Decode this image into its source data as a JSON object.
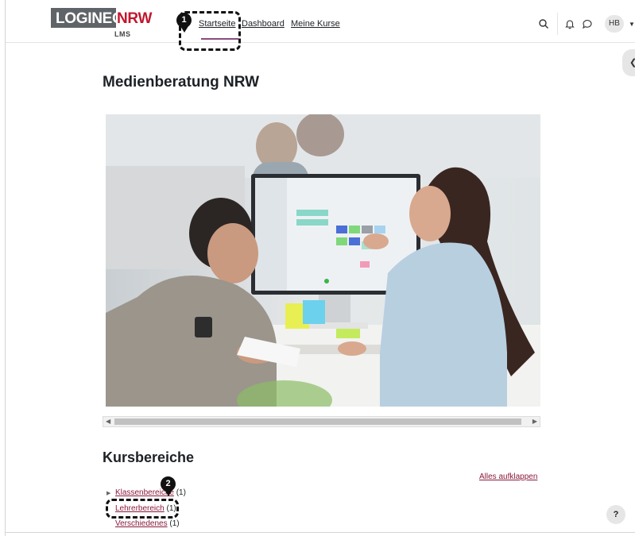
{
  "brand": {
    "logo_left": "LOGINEO",
    "logo_right": "NRW",
    "logo_sub": "LMS"
  },
  "nav": {
    "items": [
      {
        "label": "Startseite",
        "active": true
      },
      {
        "label": "Dashboard"
      },
      {
        "label": "Meine Kurse"
      }
    ]
  },
  "user": {
    "initials": "HB"
  },
  "callouts": [
    "1",
    "2"
  ],
  "page": {
    "title": "Medienberatung NRW"
  },
  "courses": {
    "title": "Kursbereiche",
    "expand_all": "Alles aufklappen",
    "categories": [
      {
        "name": "Klassenbereiche",
        "count": "(1)"
      },
      {
        "name": "Lehrerbereich",
        "count": "(1)"
      },
      {
        "name": "Verschiedenes",
        "count": "(1)"
      }
    ]
  },
  "help": {
    "label": "?"
  },
  "icons": [
    "search-icon",
    "bell-icon",
    "chat-icon",
    "chevron-down-icon",
    "chevron-left-icon",
    "triangle-right-icon",
    "question-icon"
  ],
  "colors": {
    "accent": "#8a4b7e",
    "link": "#8a1b3d",
    "brand_red": "#c3162b",
    "logo_grey": "#5f6468"
  }
}
